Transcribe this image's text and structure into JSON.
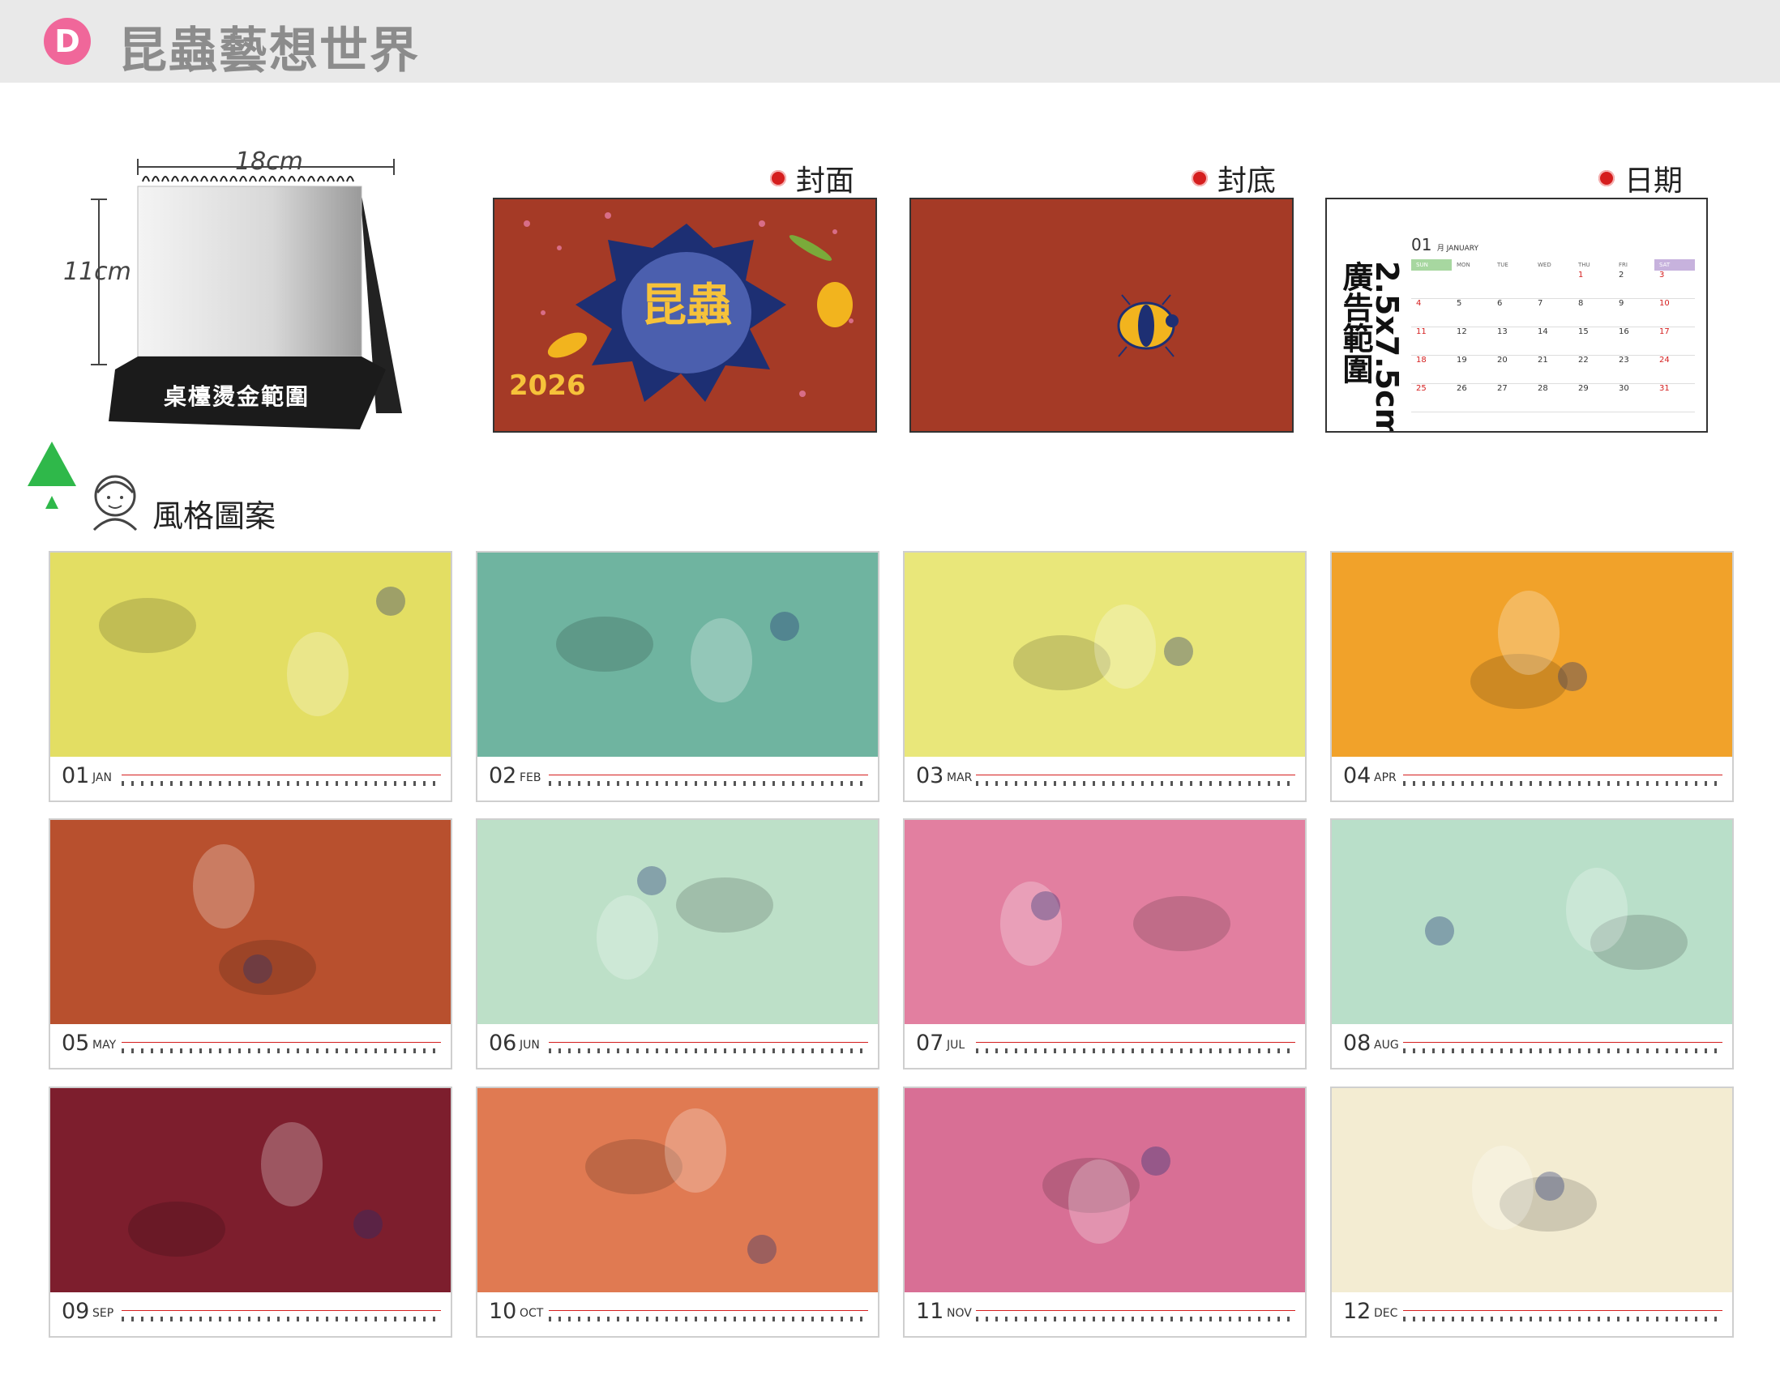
{
  "header": {
    "badge": "D",
    "title": "昆蟲藝想世界"
  },
  "product": {
    "width_label": "18cm",
    "height_label": "11cm",
    "imprint_label": "桌檯燙金範圍"
  },
  "previews": {
    "cover_label": "封面",
    "back_label": "封底",
    "date_label": "日期",
    "cover_year": "2026",
    "ad_line1": "廣告範圍",
    "ad_line2": "2.5x7.5cm"
  },
  "calendar": {
    "month_num": "01",
    "month_name": "月 JANUARY",
    "weekdays": [
      "SUN",
      "MON",
      "TUE",
      "WED",
      "THU",
      "FRI",
      "SAT"
    ],
    "rows": [
      [
        "",
        "",
        "",
        "",
        "1",
        "2",
        "3"
      ],
      [
        "4",
        "5",
        "6",
        "7",
        "8",
        "9",
        "10"
      ],
      [
        "11",
        "12",
        "13",
        "14",
        "15",
        "16",
        "17"
      ],
      [
        "18",
        "19",
        "20",
        "21",
        "22",
        "23",
        "24"
      ],
      [
        "25",
        "26",
        "27",
        "28",
        "29",
        "30",
        "31"
      ]
    ]
  },
  "style_section": {
    "label": "風格圖案"
  },
  "months": [
    {
      "num": "01",
      "name": "JAN",
      "bg": "#e3de63"
    },
    {
      "num": "02",
      "name": "FEB",
      "bg": "#6fb4a0"
    },
    {
      "num": "03",
      "name": "MAR",
      "bg": "#e9e77a"
    },
    {
      "num": "04",
      "name": "APR",
      "bg": "#f1a22a"
    },
    {
      "num": "05",
      "name": "MAY",
      "bg": "#b8502e"
    },
    {
      "num": "06",
      "name": "JUN",
      "bg": "#bde0c8"
    },
    {
      "num": "07",
      "name": "JUL",
      "bg": "#e27fa0"
    },
    {
      "num": "08",
      "name": "AUG",
      "bg": "#b9dfc9"
    },
    {
      "num": "09",
      "name": "SEP",
      "bg": "#7d1e2d"
    },
    {
      "num": "10",
      "name": "OCT",
      "bg": "#e07a52"
    },
    {
      "num": "11",
      "name": "NOV",
      "bg": "#d86f95"
    },
    {
      "num": "12",
      "name": "DEC",
      "bg": "#f3ecd2"
    }
  ],
  "colors": {
    "accent": "#f0679a",
    "dot_red": "#d51e1e",
    "cover_bg": "#a53a26"
  }
}
